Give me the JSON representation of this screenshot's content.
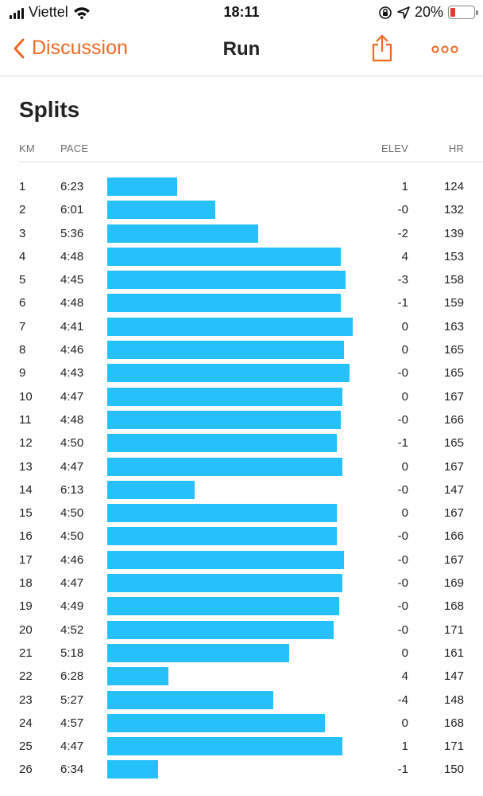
{
  "status_bar": {
    "carrier": "Viettel",
    "time": "18:11",
    "battery_percent": "20%",
    "battery_level": 0.2,
    "battery_color": "#e53935"
  },
  "nav": {
    "back_label": "Discussion",
    "title": "Run",
    "accent_color": "#f26822",
    "icons": [
      "chevron-left-icon",
      "share-icon",
      "more-icon"
    ]
  },
  "section_title": "Splits",
  "columns": {
    "km": "KM",
    "pace": "PACE",
    "elev": "ELEV",
    "hr": "HR"
  },
  "bar_color": "#26c0fa",
  "splits": [
    {
      "km": "1",
      "pace": "6:23",
      "elev": "1",
      "hr": "124"
    },
    {
      "km": "2",
      "pace": "6:01",
      "elev": "-0",
      "hr": "132"
    },
    {
      "km": "3",
      "pace": "5:36",
      "elev": "-2",
      "hr": "139"
    },
    {
      "km": "4",
      "pace": "4:48",
      "elev": "4",
      "hr": "153"
    },
    {
      "km": "5",
      "pace": "4:45",
      "elev": "-3",
      "hr": "158"
    },
    {
      "km": "6",
      "pace": "4:48",
      "elev": "-1",
      "hr": "159"
    },
    {
      "km": "7",
      "pace": "4:41",
      "elev": "0",
      "hr": "163"
    },
    {
      "km": "8",
      "pace": "4:46",
      "elev": "0",
      "hr": "165"
    },
    {
      "km": "9",
      "pace": "4:43",
      "elev": "-0",
      "hr": "165"
    },
    {
      "km": "10",
      "pace": "4:47",
      "elev": "0",
      "hr": "167"
    },
    {
      "km": "11",
      "pace": "4:48",
      "elev": "-0",
      "hr": "166"
    },
    {
      "km": "12",
      "pace": "4:50",
      "elev": "-1",
      "hr": "165"
    },
    {
      "km": "13",
      "pace": "4:47",
      "elev": "0",
      "hr": "167"
    },
    {
      "km": "14",
      "pace": "6:13",
      "elev": "-0",
      "hr": "147"
    },
    {
      "km": "15",
      "pace": "4:50",
      "elev": "0",
      "hr": "167"
    },
    {
      "km": "16",
      "pace": "4:50",
      "elev": "-0",
      "hr": "166"
    },
    {
      "km": "17",
      "pace": "4:46",
      "elev": "-0",
      "hr": "167"
    },
    {
      "km": "18",
      "pace": "4:47",
      "elev": "-0",
      "hr": "169"
    },
    {
      "km": "19",
      "pace": "4:49",
      "elev": "-0",
      "hr": "168"
    },
    {
      "km": "20",
      "pace": "4:52",
      "elev": "-0",
      "hr": "171"
    },
    {
      "km": "21",
      "pace": "5:18",
      "elev": "0",
      "hr": "161"
    },
    {
      "km": "22",
      "pace": "6:28",
      "elev": "4",
      "hr": "147"
    },
    {
      "km": "23",
      "pace": "5:27",
      "elev": "-4",
      "hr": "148"
    },
    {
      "km": "24",
      "pace": "4:57",
      "elev": "0",
      "hr": "168"
    },
    {
      "km": "25",
      "pace": "4:47",
      "elev": "1",
      "hr": "171"
    },
    {
      "km": "26",
      "pace": "6:34",
      "elev": "-1",
      "hr": "150"
    }
  ]
}
